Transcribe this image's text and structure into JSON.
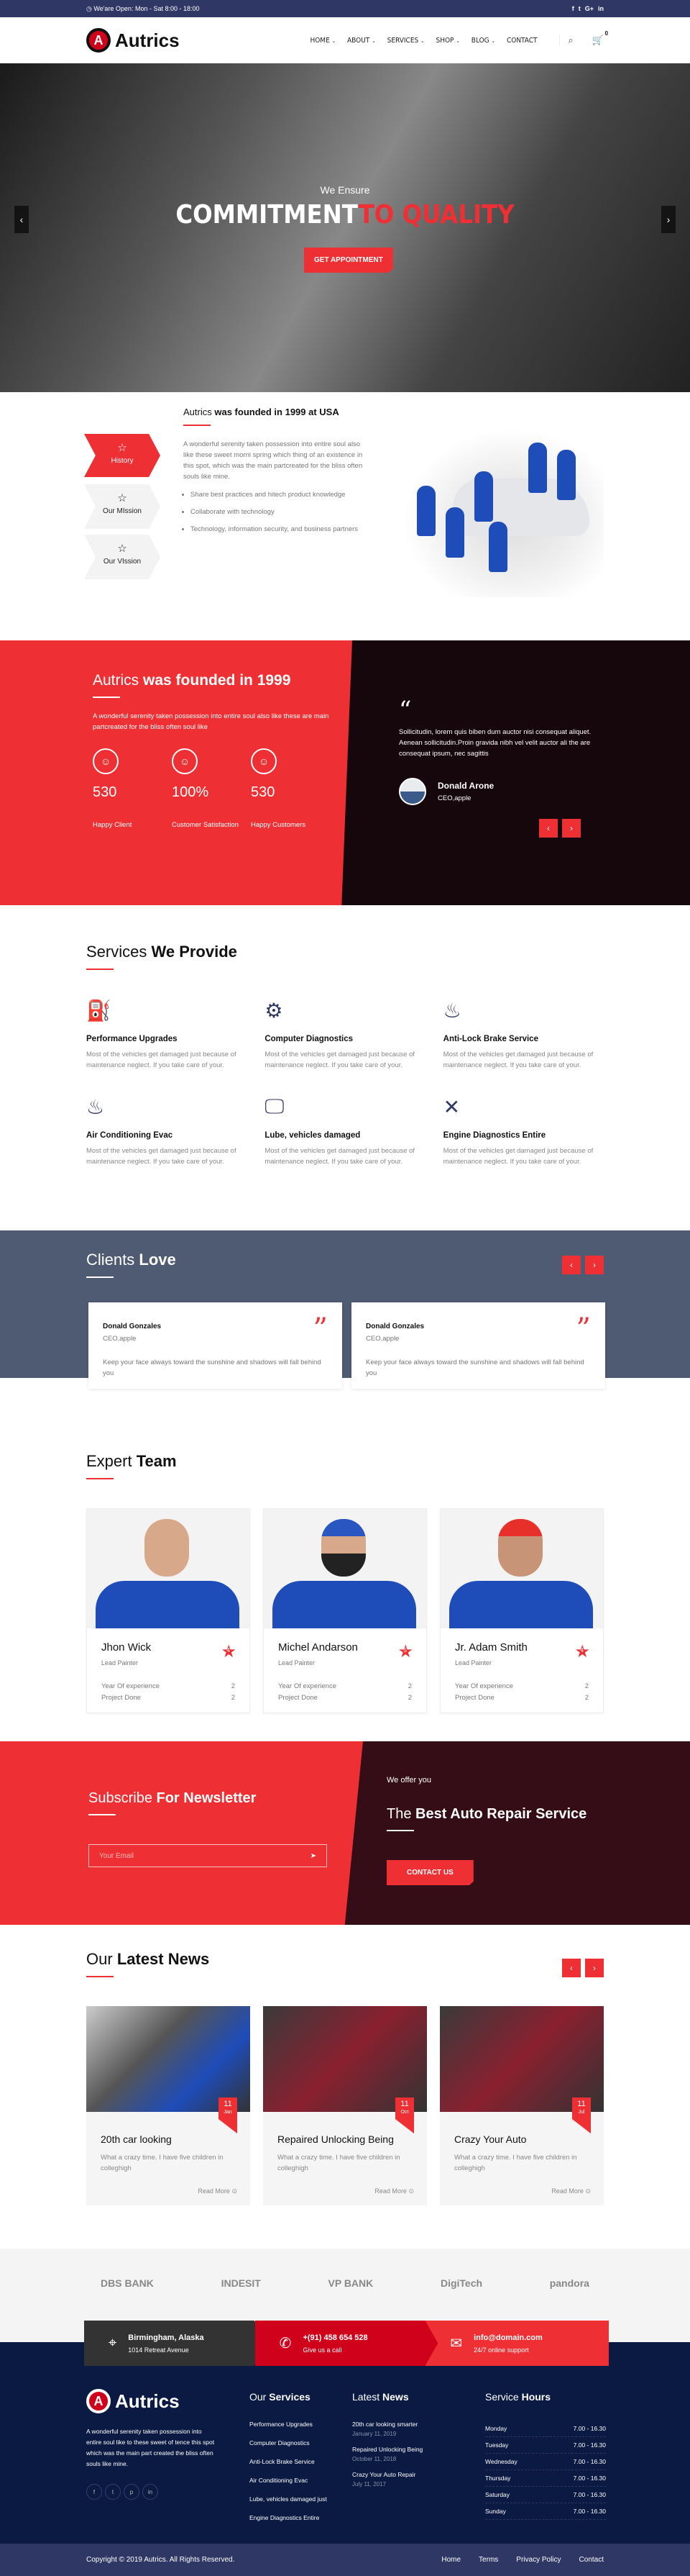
{
  "topbar": {
    "hours": "We'are Open: Mon - Sat 8:00 - 18:00",
    "social": [
      "f",
      "t",
      "G+",
      "in"
    ]
  },
  "header": {
    "logo": "Autrics",
    "logo_letter": "A",
    "nav": [
      "HOME",
      "ABOUT",
      "SERVICES",
      "SHOP",
      "BLOG",
      "CONTACT"
    ],
    "cart_count": "0"
  },
  "hero": {
    "kicker": "We Ensure",
    "title_white": "COMMITMENT",
    "title_red": "TO QUALITY",
    "button": "GET APPOINTMENT"
  },
  "about": {
    "tabs": [
      "History",
      "Our MIssion",
      "Our VIssion"
    ],
    "title_light": "Autrics",
    "title_bold": "was founded in 1999 at USA",
    "text": "A wonderful serenity taken possession into entire soul also like these sweet morni spring which thing of an existence in this spot, which was the main partcreated for the bliss often souls like mine.",
    "bullets": [
      "Share best practices and hitech product knowledge",
      "Collaborate with technology",
      "Technology, information security, and business partners"
    ]
  },
  "founded": {
    "title_light": "Autrics",
    "title_bold": "was founded in 1999",
    "text": "A wonderful serenity taken possession into entire soul also like these are main partcreated for the bliss often soul like",
    "stats": [
      {
        "num": "530",
        "label": "Happy Client"
      },
      {
        "num": "100%",
        "label": "Customer Satisfaction"
      },
      {
        "num": "530",
        "label": "Happy Customers"
      }
    ],
    "testimonial": {
      "text": "Sollicitudin, lorem quis biben dum auctor nisi consequat aliquet. Aenean sollicitudin.Proin gravida nibh vel velit auctor ali the are consequat ipsum, nec sagittis",
      "name": "Donald Arone",
      "role": "CEO,apple"
    }
  },
  "services": {
    "title_light": "Services",
    "title_bold": "We Provide",
    "items": [
      {
        "icon": "oil-bottle-icon",
        "title": "Performance Upgrades",
        "text": "Most of the vehicles get damaged just because of maintenance neglect. If you take care of your."
      },
      {
        "icon": "piston-icon",
        "title": "Computer Diagnostics",
        "text": "Most of the vehicles get damaged just because of maintenance neglect. If you take care of your."
      },
      {
        "icon": "seat-ac-icon",
        "title": "Anti-Lock Brake Service",
        "text": "Most of the vehicles get damaged just because of maintenance neglect. If you take care of your."
      },
      {
        "icon": "seat-ac-icon",
        "title": "Air Conditioning Evac",
        "text": "Most of the vehicles get damaged just because of maintenance neglect. If you take care of your."
      },
      {
        "icon": "monitor-icon",
        "title": "Lube, vehicles damaged",
        "text": "Most of the vehicles get damaged just because of maintenance neglect. If you take care of your."
      },
      {
        "icon": "tools-icon",
        "title": "Engine Diagnostics Entire",
        "text": "Most of the vehicles get damaged just because of maintenance neglect. If you take care of your."
      }
    ]
  },
  "clients": {
    "title_light": "Clients",
    "title_bold": "Love",
    "cards": [
      {
        "name": "Donald Gonzales",
        "role": "CEO,apple",
        "text": "Keep your face always toward the sunshine and shadows will fall behind you"
      },
      {
        "name": "Donald Gonzales",
        "role": "CEO,apple",
        "text": "Keep your face always toward the sunshine and shadows will fall behind you"
      }
    ]
  },
  "team": {
    "title_light": "Expert",
    "title_bold": "Team",
    "exp_label": "Year Of experience",
    "proj_label": "Project Done",
    "members": [
      {
        "name": "Jhon Wick",
        "role": "Lead Painter",
        "rating": "4",
        "experience": "2",
        "projects": "2"
      },
      {
        "name": "Michel Andarson",
        "role": "Lead Painter",
        "rating": "5",
        "experience": "2",
        "projects": "2"
      },
      {
        "name": "Jr. Adam Smith",
        "role": "Lead Painter",
        "rating": "4",
        "experience": "2",
        "projects": "2"
      }
    ]
  },
  "subscribe": {
    "title_light": "Subscribe",
    "title_bold": "For Newsletter",
    "placeholder": "Your Email",
    "offer": "We offer you",
    "offer_light": "The",
    "offer_bold": "Best Auto Repair Service",
    "button": "CONTACT US"
  },
  "news": {
    "title_light": "Our",
    "title_bold": "Latest News",
    "read_more": "Read More",
    "items": [
      {
        "day": "11",
        "month": "Jan",
        "title": "20th car looking",
        "text": "What a crazy time. I have five children in colleghigh"
      },
      {
        "day": "11",
        "month": "Oct",
        "title": "Repaired Unlocking Being",
        "text": "What a crazy time. I have five children in colleghigh"
      },
      {
        "day": "11",
        "month": "Jul",
        "title": "Crazy Your Auto",
        "text": "What a crazy time. I have five children in colleghigh"
      }
    ]
  },
  "partners": [
    "DBS BANK",
    "INDESIT",
    "VP BANK",
    "DigiTech",
    "pandora"
  ],
  "contact": [
    {
      "title": "Birmingham, Alaska",
      "sub": "1014 Retreat Avenue",
      "color": "#333333"
    },
    {
      "title": "+(91) 458 654 528",
      "sub": "Give us a call",
      "color": "#d0021b"
    },
    {
      "title": "info@domain.com",
      "sub": "24/7 online support",
      "color": "#ee2f33"
    }
  ],
  "footer": {
    "about": "A wonderful serenity taken possession into entire soul like to these sweet of tence this spot which was the main part created the bliss often souls like mine.",
    "social": [
      "f",
      "t",
      "p",
      "in"
    ],
    "services_title_light": "Our",
    "services_title_bold": "Services",
    "services": [
      "Performance Upgrades",
      "Computer Diagnostics",
      "Anti-Lock Brake Service",
      "Air Conditioning Evac",
      "Lube, vehicles damaged just",
      "Engine Diagnostics Entire"
    ],
    "news_title_light": "Latest",
    "news_title_bold": "News",
    "news": [
      {
        "title": "20th car looking smarter",
        "date": "January 11, 2019"
      },
      {
        "title": "Repaired Unlocking Being",
        "date": "October 11, 2018"
      },
      {
        "title": "Crazy Your Auto Repair",
        "date": "July 11, 2017"
      }
    ],
    "hours_title_light": "Service",
    "hours_title_bold": "Hours",
    "hours": [
      {
        "day": "Monday",
        "time": "7.00 - 16.30"
      },
      {
        "day": "Tuesday",
        "time": "7.00 - 16.30"
      },
      {
        "day": "Wednesday",
        "time": "7.00 - 16.30"
      },
      {
        "day": "Thursday",
        "time": "7.00 - 16.30"
      },
      {
        "day": "Saturday",
        "time": "7.00 - 16.30"
      },
      {
        "day": "Sunday",
        "time": "7.00 - 16.30"
      }
    ]
  },
  "bottom": {
    "copyright": "Copyright © 2019 Autrics. All Rights Reserved.",
    "links": [
      "Home",
      "Terms",
      "Privacy Policy",
      "Contact"
    ]
  },
  "colors": {
    "accent": "#ee2f33",
    "navy": "#2f3864",
    "footer": "#0b1a42",
    "slate": "#4f5a73",
    "maroon": "#350d16"
  }
}
